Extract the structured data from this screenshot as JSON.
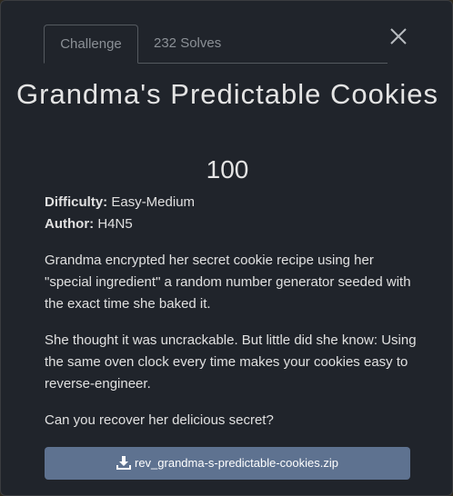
{
  "tabs": {
    "challenge": "Challenge",
    "solves": "232 Solves"
  },
  "challenge": {
    "title": "Grandma's Predictable Cookies",
    "points": "100",
    "difficulty_label": "Difficulty:",
    "difficulty_value": "Easy-Medium",
    "author_label": "Author:",
    "author_value": "H4N5",
    "description": [
      "Grandma encrypted her secret cookie recipe using her \"special ingredient\" a random number generator seeded with the exact time she baked it.",
      "She thought it was uncrackable. But little did she know: Using the same oven clock every time makes your cookies easy to reverse-engineer.",
      "Can you recover her delicious secret?"
    ]
  },
  "download": {
    "filename": "rev_grandma-s-predictable-cookies.zip",
    "icon": "download-icon"
  },
  "icons": {
    "close": "close-icon"
  },
  "colors": {
    "modal_bg": "#20242b",
    "button_bg": "#5e7290",
    "muted_text": "#8b9096"
  }
}
